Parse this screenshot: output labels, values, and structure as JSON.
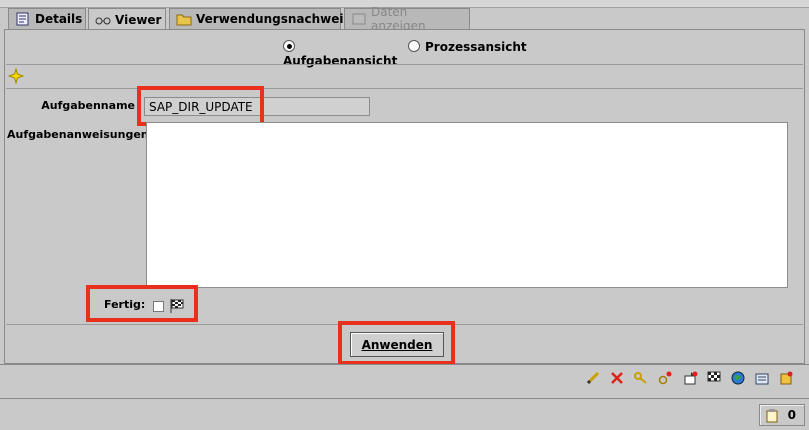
{
  "tabs": [
    {
      "label": "Details"
    },
    {
      "label": "Viewer"
    },
    {
      "label": "Verwendungsnachweis"
    },
    {
      "label": "Daten anzeigen"
    }
  ],
  "view_mode": {
    "options": [
      "Aufgabenansicht",
      "Prozessansicht"
    ],
    "selected": "Aufgabenansicht"
  },
  "form": {
    "task_name_label": "Aufgabenname",
    "task_name_value": "SAP_DIR_UPDATE",
    "instructions_label": "Aufgabenanweisungen:",
    "instructions_value": "",
    "done_label": "Fertig:",
    "done_checked": false,
    "apply_button": "Anwenden"
  },
  "toolbar_icons": [
    "edit-icon",
    "delete-icon",
    "key-icon",
    "link-icon",
    "export-icon",
    "checkered-flag-icon",
    "globe-icon",
    "list-icon",
    "tasks-icon"
  ],
  "status_bar": {
    "count": "0"
  }
}
